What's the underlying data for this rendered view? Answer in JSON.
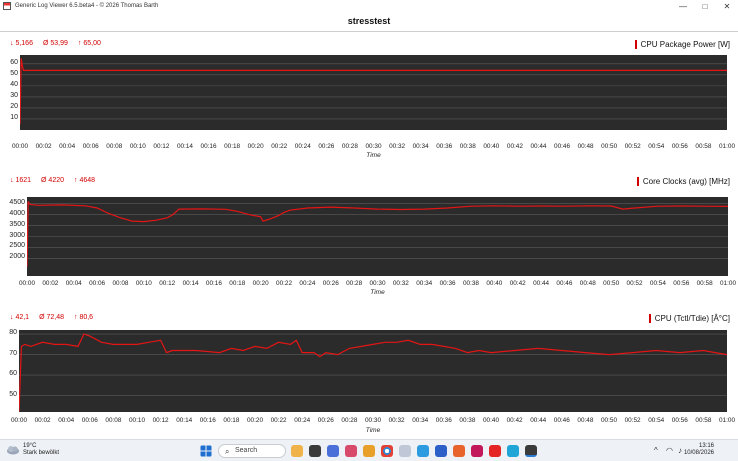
{
  "window": {
    "title": "Generic Log Viewer 6.5.beta4 - © 2026 Thomas Barth",
    "controls": {
      "minimize": "—",
      "maximize": "□",
      "close": "✕"
    }
  },
  "document": {
    "title": "stresstest"
  },
  "time_ticks": [
    "00:00",
    "00:02",
    "00:04",
    "00:06",
    "00:08",
    "00:10",
    "00:12",
    "00:14",
    "00:16",
    "00:18",
    "00:20",
    "00:22",
    "00:24",
    "00:26",
    "00:28",
    "00:30",
    "00:32",
    "00:34",
    "00:36",
    "00:38",
    "00:40",
    "00:42",
    "00:44",
    "00:46",
    "00:48",
    "00:50",
    "00:52",
    "00:54",
    "00:56",
    "00:58",
    "01:00"
  ],
  "chart_data": [
    {
      "type": "line",
      "title": "CPU Package Power [W]",
      "xlabel": "Time",
      "x_range_minutes": [
        0,
        60
      ],
      "ylim": [
        0,
        68
      ],
      "yticks": [
        "60",
        "50",
        "40",
        "30",
        "20",
        "10"
      ],
      "ytick_values": [
        60,
        50,
        40,
        30,
        20,
        10
      ],
      "stats": {
        "min": "5,166",
        "avg": "53,99",
        "max": "65,00"
      },
      "series": [
        {
          "color": "#e31515",
          "x": [
            0,
            0.1,
            0.2,
            0.3,
            60
          ],
          "y": [
            5.2,
            65,
            58,
            54,
            54
          ]
        }
      ]
    },
    {
      "type": "line",
      "title": "Core Clocks (avg) [MHz]",
      "xlabel": "Time",
      "x_range_minutes": [
        0,
        60
      ],
      "ylim": [
        1200,
        4800
      ],
      "yticks": [
        "4500",
        "4000",
        "3500",
        "3000",
        "2500",
        "2000"
      ],
      "ytick_values": [
        4500,
        4000,
        3500,
        3000,
        2500,
        2000
      ],
      "stats": {
        "min": "1621",
        "avg": "4220",
        "max": "4648"
      },
      "series": [
        {
          "color": "#e31515",
          "x": [
            0,
            0.1,
            0.2,
            0.4,
            1,
            3,
            5,
            6,
            7,
            8,
            9,
            10,
            11,
            12,
            12.5,
            13,
            15,
            17,
            18,
            19,
            20,
            20.2,
            20.8,
            21.5,
            22,
            22.5,
            24,
            26,
            28,
            30,
            32,
            34,
            36,
            38,
            40,
            42,
            44,
            46,
            48,
            50,
            51,
            52,
            54,
            56,
            58,
            60
          ],
          "y": [
            1621,
            4600,
            4480,
            4450,
            4420,
            4440,
            4400,
            4300,
            4050,
            3850,
            3700,
            3680,
            3740,
            3850,
            4000,
            4250,
            4260,
            4240,
            4150,
            4000,
            3900,
            3700,
            3800,
            3950,
            4100,
            4200,
            4300,
            4340,
            4300,
            4250,
            4230,
            4250,
            4300,
            4380,
            4400,
            4380,
            4390,
            4380,
            4400,
            4390,
            4250,
            4300,
            4380,
            4390,
            4380,
            4370
          ]
        }
      ]
    },
    {
      "type": "line",
      "title": "CPU (Tctl/Tdie) [Â°C]",
      "xlabel": "Time",
      "x_range_minutes": [
        0,
        60
      ],
      "ylim": [
        42,
        82
      ],
      "yticks": [
        "80",
        "70",
        "60",
        "50"
      ],
      "ytick_values": [
        80,
        70,
        60,
        50
      ],
      "stats": {
        "min": "42,1",
        "avg": "72,48",
        "max": "80,6"
      },
      "series": [
        {
          "color": "#e31515",
          "x": [
            0,
            0.2,
            0.5,
            1,
            2,
            3,
            4,
            5,
            5.5,
            6,
            7,
            8,
            10,
            11,
            12,
            12.5,
            13,
            15,
            17,
            18,
            19,
            20,
            21,
            22,
            23,
            23.5,
            24,
            25,
            25.5,
            26,
            27,
            28,
            29,
            30,
            31,
            32,
            33,
            34,
            35,
            36,
            37,
            38,
            39,
            40,
            42,
            44,
            46,
            48,
            50,
            52,
            54,
            56,
            58,
            59,
            60
          ],
          "y": [
            42.1,
            74,
            75,
            74,
            76,
            75,
            75,
            74,
            80,
            79,
            76,
            75,
            75,
            76,
            77,
            71,
            72,
            72,
            71,
            73,
            72,
            74,
            73,
            76,
            75,
            77,
            71,
            71,
            69,
            71,
            70,
            73,
            74,
            75,
            76,
            76,
            77,
            75,
            75,
            74,
            73,
            71,
            72,
            71,
            72,
            73,
            72,
            71,
            70,
            71,
            72,
            71,
            72,
            71,
            70
          ]
        }
      ]
    }
  ],
  "taskbar": {
    "weather": {
      "temp": "19°C",
      "desc": "Stark bewölkt"
    },
    "search_label": "Search",
    "clock": {
      "time": "13:16",
      "date": "10/08/2026"
    },
    "tray": {
      "chevron": "^",
      "wifi": "◠",
      "volume": "♪"
    }
  }
}
